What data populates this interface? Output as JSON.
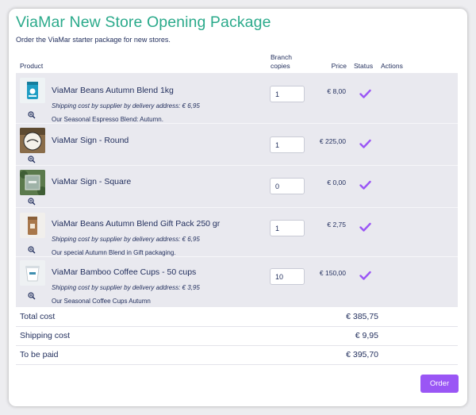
{
  "page": {
    "title": "ViaMar New Store Opening Package",
    "subtitle": "Order the ViaMar starter package for new stores."
  },
  "table": {
    "headers": {
      "product": "Product",
      "branch_line1": "Branch",
      "branch_line2": "copies",
      "price": "Price",
      "status": "Status",
      "actions": "Actions"
    },
    "rows": [
      {
        "name": "ViaMar Beans Autumn Blend 1kg",
        "shipping": "Shipping cost by supplier by delivery address: € 6,95",
        "description": "Our Seasonal Espresso Blend: Autumn.",
        "quantity": "1",
        "price": "€ 8,00",
        "status_icon": "check-icon",
        "thumb_icon": "coffee-bag-image"
      },
      {
        "name": "ViaMar Sign - Round",
        "shipping": "",
        "description": "",
        "quantity": "1",
        "price": "€ 225,00",
        "status_icon": "check-icon",
        "thumb_icon": "round-sign-image"
      },
      {
        "name": "ViaMar Sign - Square",
        "shipping": "",
        "description": "",
        "quantity": "0",
        "price": "€ 0,00",
        "status_icon": "check-icon",
        "thumb_icon": "square-sign-image"
      },
      {
        "name": "ViaMar Beans Autumn Blend Gift Pack 250 gr",
        "shipping": "Shipping cost by supplier by delivery address: € 6,95",
        "description": "Our special Autumn Blend in Gift packaging.",
        "quantity": "1",
        "price": "€ 2,75",
        "status_icon": "check-icon",
        "thumb_icon": "gift-pack-image"
      },
      {
        "name": "ViaMar Bamboo Coffee Cups - 50 cups",
        "shipping": "Shipping cost by supplier by delivery address: € 3,95",
        "description": "Our Seasonal Coffee Cups Autumn",
        "quantity": "10",
        "price": "€ 150,00",
        "status_icon": "check-icon",
        "thumb_icon": "coffee-cups-image"
      }
    ]
  },
  "summary": {
    "total_label": "Total cost",
    "total_value": "€ 385,75",
    "shipping_label": "Shipping cost",
    "shipping_value": "€ 9,95",
    "paid_label": "To be paid",
    "paid_value": "€ 395,70"
  },
  "actions": {
    "order_label": "Order"
  },
  "colors": {
    "title": "#2baa8b",
    "accent": "#9a56f5",
    "text": "#23305e",
    "row_bg": "#e9e9ef"
  }
}
